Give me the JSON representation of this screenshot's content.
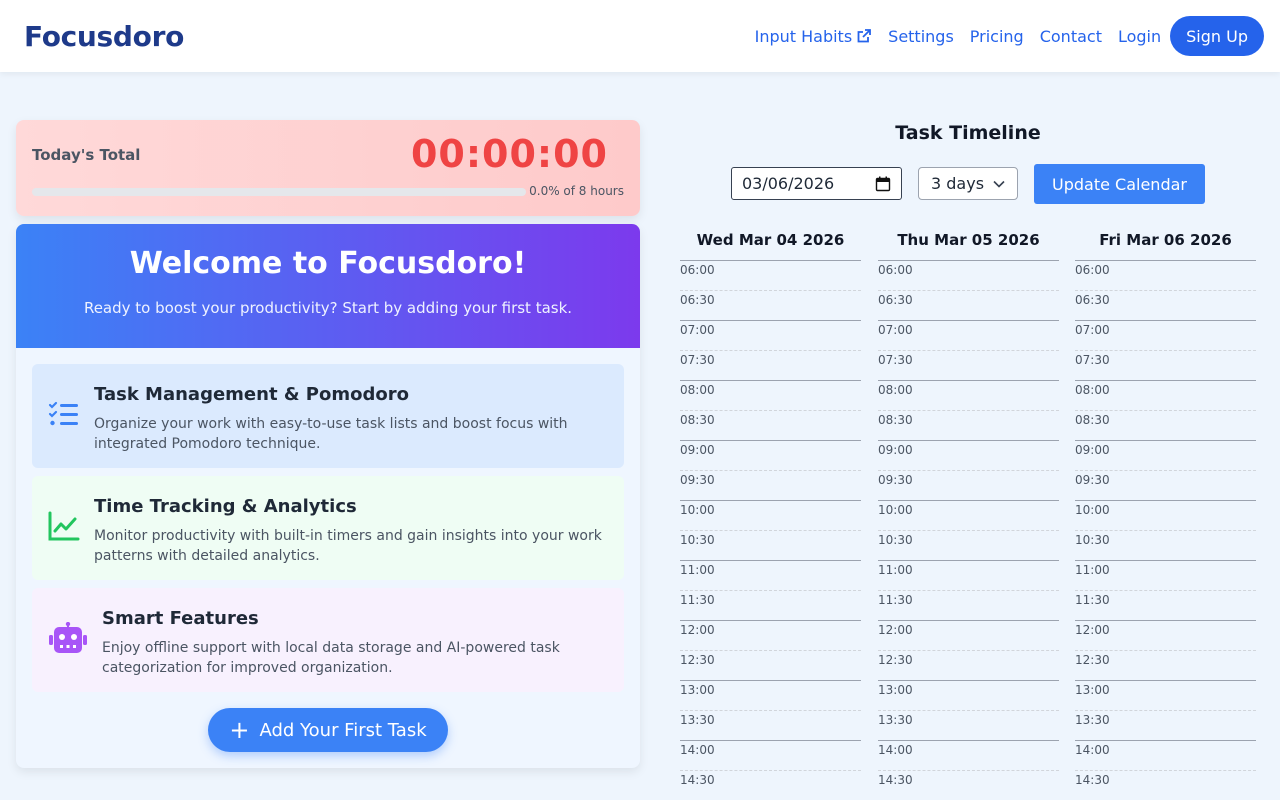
{
  "header": {
    "brand": "Focusdoro",
    "nav": [
      "Input Habits",
      "Settings",
      "Pricing",
      "Contact",
      "Login"
    ],
    "signup": "Sign Up"
  },
  "today": {
    "label": "Today's Total",
    "time": "00:00:00",
    "progress_percent": 0,
    "progress_text": "0.0% of 8 hours"
  },
  "welcome": {
    "title": "Welcome to Focusdoro!",
    "subtitle": "Ready to boost your productivity? Start by adding your first task.",
    "features": [
      {
        "title": "Task Management & Pomodoro",
        "desc": "Organize your work with easy-to-use task lists and boost focus with integrated Pomodoro technique.",
        "icon": "task-list-icon"
      },
      {
        "title": "Time Tracking & Analytics",
        "desc": "Monitor productivity with built-in timers and gain insights into your work patterns with detailed analytics.",
        "icon": "chart-line-icon"
      },
      {
        "title": "Smart Features",
        "desc": "Enjoy offline support with local data storage and AI-powered task categorization for improved organization.",
        "icon": "robot-icon"
      }
    ],
    "add_button": "Add Your First Task"
  },
  "timeline": {
    "title": "Task Timeline",
    "date_value": "03/06/2026",
    "days_value": "3 days",
    "update_button": "Update Calendar",
    "days": [
      "Wed Mar 04 2026",
      "Thu Mar 05 2026",
      "Fri Mar 06 2026"
    ],
    "slots": [
      "06:00",
      "06:30",
      "07:00",
      "07:30",
      "08:00",
      "08:30",
      "09:00",
      "09:30",
      "10:00",
      "10:30",
      "11:00",
      "11:30",
      "12:00",
      "12:30",
      "13:00",
      "13:30",
      "14:00",
      "14:30"
    ]
  },
  "colors": {
    "brand": "#1e3a8a",
    "accent": "#2563eb",
    "timer": "#ef4444",
    "gradient_start": "#3b82f6",
    "gradient_end": "#7c3aed"
  }
}
